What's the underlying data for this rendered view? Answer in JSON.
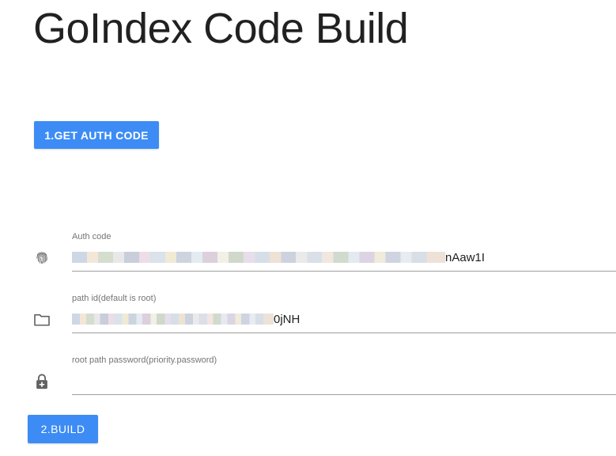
{
  "page": {
    "title": "GoIndex Code Build"
  },
  "buttons": {
    "get_auth_code": "1.GET AUTH CODE",
    "build": "2.BUILD"
  },
  "fields": {
    "auth_code": {
      "label": "Auth code",
      "value_visible_suffix": "nAaw1I",
      "icon": "fingerprint-icon"
    },
    "path_id": {
      "label": "path id(default is root)",
      "value_visible_suffix": "0jNH",
      "icon": "folder-icon"
    },
    "root_password": {
      "label": "root path password(priority.password)",
      "value": "",
      "icon": "lock-plus-icon"
    }
  },
  "colors": {
    "accent": "#3d8cf5",
    "text": "#212121",
    "label": "#757575",
    "underline": "#9e9e9e"
  }
}
